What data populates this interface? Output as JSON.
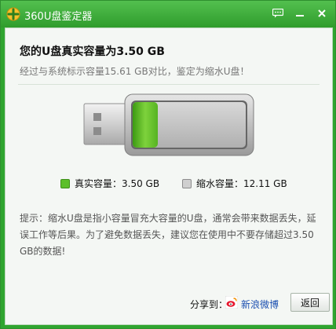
{
  "window": {
    "title": "360U盘鉴定器",
    "controls": {
      "feedback_icon": "feedback-bubble-icon",
      "minimize_icon": "minimize-icon",
      "close_icon": "close-icon"
    }
  },
  "result": {
    "headline": "您的U盘真实容量为3.50 GB",
    "subline": "经过与系统标示容量15.61 GB对比，鉴定为缩水U盘！"
  },
  "legend": {
    "real_label": "真实容量：3.50 GB",
    "shrink_label": "缩水容量：12.11 GB",
    "real_color": "#5cbf2a",
    "shrink_color": "#cfcfcf"
  },
  "capacity": {
    "real_fraction": 0.224
  },
  "tip": {
    "text": "提示：缩水U盘是指小容量冒充大容量的U盘，通常会带来数据丢失，延误工作等后果。为了避免数据丢失，建议您在使用中不要存储超过3.50 GB的数据!"
  },
  "footer": {
    "share_label": "分享到：",
    "weibo_label": "新浪微博",
    "back_label": "返回"
  }
}
